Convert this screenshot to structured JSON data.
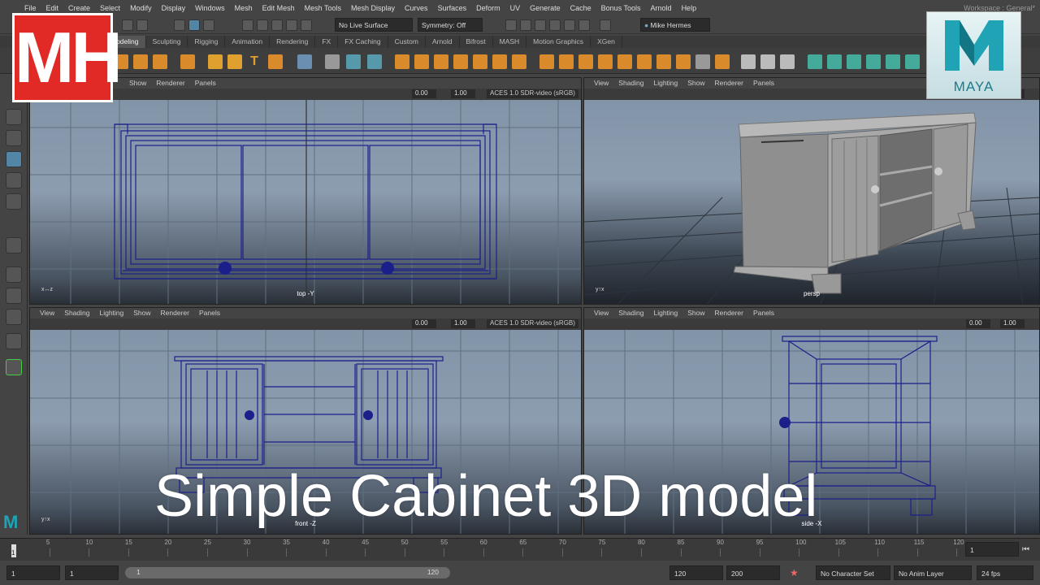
{
  "menu": [
    "File",
    "Edit",
    "Create",
    "Select",
    "Modify",
    "Display",
    "Windows",
    "Mesh",
    "Edit Mesh",
    "Mesh Tools",
    "Mesh Display",
    "Curves",
    "Surfaces",
    "Deform",
    "UV",
    "Generate",
    "Cache",
    "Bonus Tools",
    "Arnold",
    "Help"
  ],
  "workspace": "Workspace : General*",
  "status": {
    "live_surface": "No Live Surface",
    "symmetry": "Symmetry: Off",
    "user": "Mike Hermes"
  },
  "shelf_tabs": [
    "Modeling",
    "Sculpting",
    "Rigging",
    "Animation",
    "Rendering",
    "FX",
    "FX Caching",
    "Custom",
    "Arnold",
    "Bifrost",
    "MASH",
    "Motion Graphics",
    "XGen"
  ],
  "shelf_active": "Modeling",
  "viewport_menu": [
    "View",
    "Shading",
    "Lighting",
    "Show",
    "Renderer",
    "Panels"
  ],
  "viewport_bar": {
    "value_a": "0.00",
    "value_b": "1.00",
    "color_mgmt": "ACES 1.0 SDR-video (sRGB)"
  },
  "viewports": {
    "top": "top -Y",
    "persp": "persp",
    "front": "front -Z",
    "side": "side -X"
  },
  "timeline": {
    "ticks": [
      "5",
      "10",
      "15",
      "20",
      "25",
      "30",
      "35",
      "40",
      "45",
      "50",
      "55",
      "60",
      "65",
      "70",
      "75",
      "80",
      "85",
      "90",
      "95",
      "100",
      "105",
      "110",
      "115",
      "120"
    ],
    "current_frame": "1",
    "current_frame_field": "1"
  },
  "range": {
    "start": "1",
    "start2": "1",
    "slider_start": "1",
    "slider_end": "120",
    "end": "120",
    "end2": "200",
    "character_set": "No Character Set",
    "anim_layer": "No Anim Layer",
    "fps": "24 fps"
  },
  "overlay_title": "Simple Cabinet 3D model",
  "logo_mh": "MH",
  "logo_maya": "MAYA",
  "colors": {
    "wire": "#1b1f8a",
    "mh_red": "#e12a26",
    "maya_teal": "#1f7b8a",
    "select_blue": "#5285a6"
  }
}
